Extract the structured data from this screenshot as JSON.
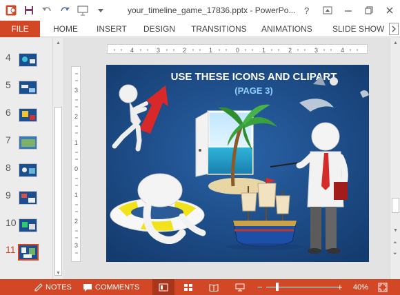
{
  "window": {
    "title": "your_timeline_game_17836.pptx - PowerPo...",
    "controls": [
      "help-icon",
      "ribbon-display-icon",
      "minimize-icon",
      "restore-icon",
      "close-icon"
    ]
  },
  "quick_access": [
    "powerpoint-logo-icon",
    "save-icon",
    "undo-icon",
    "redo-icon",
    "start-from-beginning-icon",
    "customize-qat-icon"
  ],
  "ribbon": {
    "file": "FILE",
    "tabs": [
      "HOME",
      "INSERT",
      "DESIGN",
      "TRANSITIONS",
      "ANIMATIONS",
      "SLIDE SHOW"
    ]
  },
  "thumbnails": {
    "numbers": [
      "4",
      "5",
      "6",
      "7",
      "8",
      "9",
      "10",
      "11"
    ],
    "active": "11"
  },
  "ruler": {
    "horizontal": [
      "4",
      "3",
      "2",
      "1",
      "0",
      "1",
      "2",
      "3",
      "4"
    ],
    "vertical": [
      "3",
      "2",
      "1",
      "0",
      "1",
      "2",
      "3"
    ]
  },
  "slide": {
    "title": "USE THESE ICONS AND CLIPART",
    "subtitle": "(PAGE 3)"
  },
  "statusbar": {
    "notes": "NOTES",
    "comments": "COMMENTS",
    "zoom": "40%",
    "zoom_minus": "−",
    "zoom_plus": "+"
  },
  "colors": {
    "accent": "#d24726",
    "slide_bg": "#1d4e8a"
  }
}
